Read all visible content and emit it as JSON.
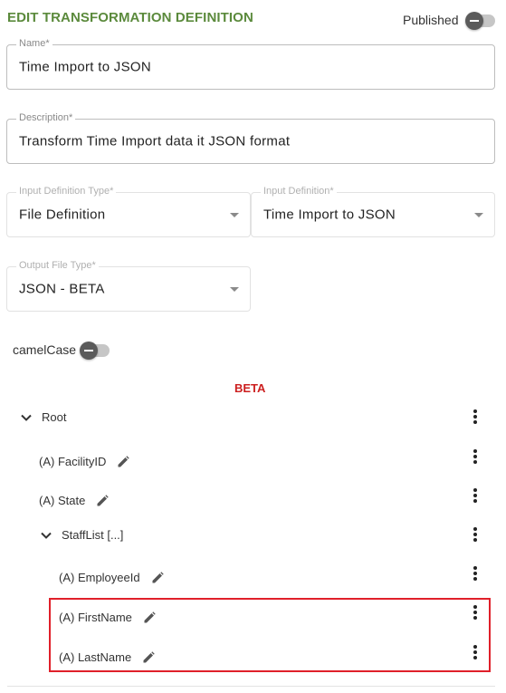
{
  "header": {
    "title": "EDIT TRANSFORMATION DEFINITION",
    "published_label": "Published"
  },
  "form": {
    "name": {
      "label": "Name*",
      "value": "Time Import to JSON"
    },
    "description": {
      "label": "Description*",
      "value": "Transform Time Import data it JSON format"
    },
    "input_definition_type": {
      "label": "Input Definition Type*",
      "value": "File Definition"
    },
    "input_definition": {
      "label": "Input Definition*",
      "value": "Time Import to JSON"
    },
    "output_file_type": {
      "label": "Output File Type*",
      "value": "JSON - BETA"
    },
    "camelcase_label": "camelCase"
  },
  "beta_label": "BETA",
  "tree": {
    "nodes": [
      {
        "label": "Root",
        "expandable": true,
        "editable": false
      },
      {
        "label": "(A) FacilityID",
        "expandable": false,
        "editable": true
      },
      {
        "label": "(A) State",
        "expandable": false,
        "editable": true
      },
      {
        "label": "StaffList [...]",
        "expandable": true,
        "editable": false
      },
      {
        "label": "(A) EmployeeId",
        "expandable": false,
        "editable": true
      },
      {
        "label": "(A) FirstName",
        "expandable": false,
        "editable": true
      },
      {
        "label": "(A) LastName",
        "expandable": false,
        "editable": true
      }
    ]
  },
  "colors": {
    "title": "#5b8a3c",
    "beta": "#cc1f1f",
    "highlight": "#e0202a"
  },
  "toggles": {
    "published": false,
    "camelcase": false
  }
}
